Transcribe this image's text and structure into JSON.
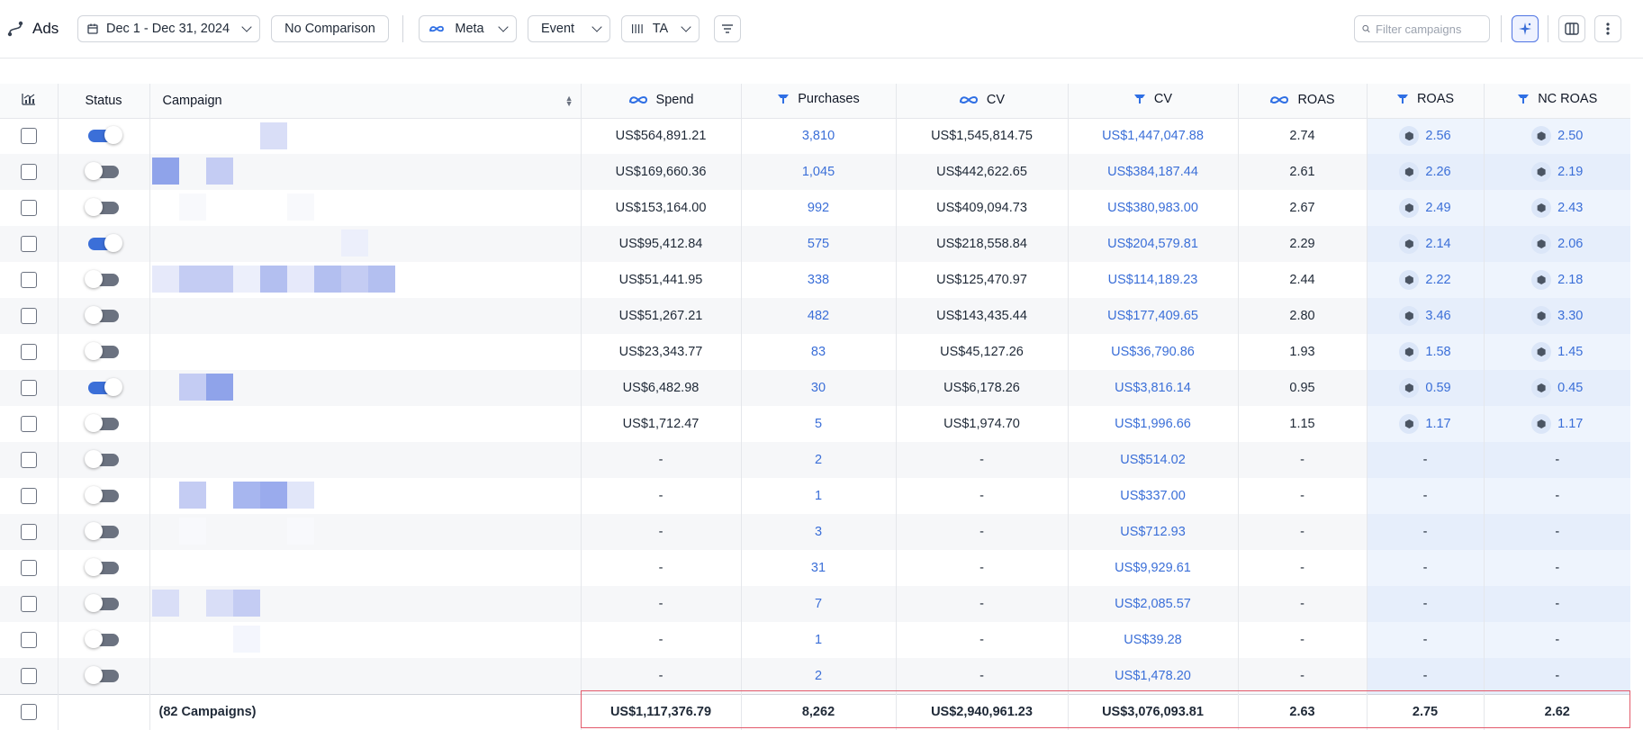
{
  "toolbar": {
    "title": "Ads",
    "date_range": "Dec 1 - Dec 31, 2024",
    "comparison": "No Comparison",
    "platform": "Meta",
    "event": "Event",
    "attribution": "TA",
    "search_placeholder": "Filter campaigns"
  },
  "columns": {
    "status": "Status",
    "campaign": "Campaign",
    "spend": "Spend",
    "purchases": "Purchases",
    "meta_cv": "CV",
    "tw_cv": "CV",
    "meta_roas": "ROAS",
    "tw_roas": "ROAS",
    "nc_roas": "NC ROAS"
  },
  "colors": {
    "accent": "#3b6fd8",
    "highlight_border": "#e35a6b",
    "toggle_on": "#3b6fd8",
    "toggle_off": "#6b7280"
  },
  "rows": [
    {
      "status": "on",
      "spend": "US$564,891.21",
      "purchases": "3,810",
      "meta_cv": "US$1,545,814.75",
      "tw_cv": "US$1,447,047.88",
      "meta_roas": "2.74",
      "tw_roas": "2.56",
      "nc_roas": "2.50"
    },
    {
      "status": "off",
      "spend": "US$169,660.36",
      "purchases": "1,045",
      "meta_cv": "US$442,622.65",
      "tw_cv": "US$384,187.44",
      "meta_roas": "2.61",
      "tw_roas": "2.26",
      "nc_roas": "2.19"
    },
    {
      "status": "off",
      "spend": "US$153,164.00",
      "purchases": "992",
      "meta_cv": "US$409,094.73",
      "tw_cv": "US$380,983.00",
      "meta_roas": "2.67",
      "tw_roas": "2.49",
      "nc_roas": "2.43"
    },
    {
      "status": "on",
      "spend": "US$95,412.84",
      "purchases": "575",
      "meta_cv": "US$218,558.84",
      "tw_cv": "US$204,579.81",
      "meta_roas": "2.29",
      "tw_roas": "2.14",
      "nc_roas": "2.06"
    },
    {
      "status": "off",
      "spend": "US$51,441.95",
      "purchases": "338",
      "meta_cv": "US$125,470.97",
      "tw_cv": "US$114,189.23",
      "meta_roas": "2.44",
      "tw_roas": "2.22",
      "nc_roas": "2.18"
    },
    {
      "status": "off",
      "spend": "US$51,267.21",
      "purchases": "482",
      "meta_cv": "US$143,435.44",
      "tw_cv": "US$177,409.65",
      "meta_roas": "2.80",
      "tw_roas": "3.46",
      "nc_roas": "3.30"
    },
    {
      "status": "off",
      "spend": "US$23,343.77",
      "purchases": "83",
      "meta_cv": "US$45,127.26",
      "tw_cv": "US$36,790.86",
      "meta_roas": "1.93",
      "tw_roas": "1.58",
      "nc_roas": "1.45"
    },
    {
      "status": "on",
      "spend": "US$6,482.98",
      "purchases": "30",
      "meta_cv": "US$6,178.26",
      "tw_cv": "US$3,816.14",
      "meta_roas": "0.95",
      "tw_roas": "0.59",
      "nc_roas": "0.45"
    },
    {
      "status": "off",
      "spend": "US$1,712.47",
      "purchases": "5",
      "meta_cv": "US$1,974.70",
      "tw_cv": "US$1,996.66",
      "meta_roas": "1.15",
      "tw_roas": "1.17",
      "nc_roas": "1.17"
    },
    {
      "status": "off",
      "spend": "-",
      "purchases": "2",
      "meta_cv": "-",
      "tw_cv": "US$514.02",
      "meta_roas": "-",
      "tw_roas": "-",
      "nc_roas": "-"
    },
    {
      "status": "off",
      "spend": "-",
      "purchases": "1",
      "meta_cv": "-",
      "tw_cv": "US$337.00",
      "meta_roas": "-",
      "tw_roas": "-",
      "nc_roas": "-"
    },
    {
      "status": "off",
      "spend": "-",
      "purchases": "3",
      "meta_cv": "-",
      "tw_cv": "US$712.93",
      "meta_roas": "-",
      "tw_roas": "-",
      "nc_roas": "-"
    },
    {
      "status": "off",
      "spend": "-",
      "purchases": "31",
      "meta_cv": "-",
      "tw_cv": "US$9,929.61",
      "meta_roas": "-",
      "tw_roas": "-",
      "nc_roas": "-"
    },
    {
      "status": "off",
      "spend": "-",
      "purchases": "7",
      "meta_cv": "-",
      "tw_cv": "US$2,085.57",
      "meta_roas": "-",
      "tw_roas": "-",
      "nc_roas": "-"
    },
    {
      "status": "off",
      "spend": "-",
      "purchases": "1",
      "meta_cv": "-",
      "tw_cv": "US$39.28",
      "meta_roas": "-",
      "tw_roas": "-",
      "nc_roas": "-"
    },
    {
      "status": "off",
      "spend": "-",
      "purchases": "2",
      "meta_cv": "-",
      "tw_cv": "US$1,478.20",
      "meta_roas": "-",
      "tw_roas": "-",
      "nc_roas": "-"
    }
  ],
  "totals": {
    "campaign_count": "(82 Campaigns)",
    "spend": "US$1,117,376.79",
    "purchases": "8,262",
    "meta_cv": "US$2,940,961.23",
    "tw_cv": "US$3,076,093.81",
    "meta_roas": "2.63",
    "tw_roas": "2.75",
    "nc_roas": "2.62"
  }
}
